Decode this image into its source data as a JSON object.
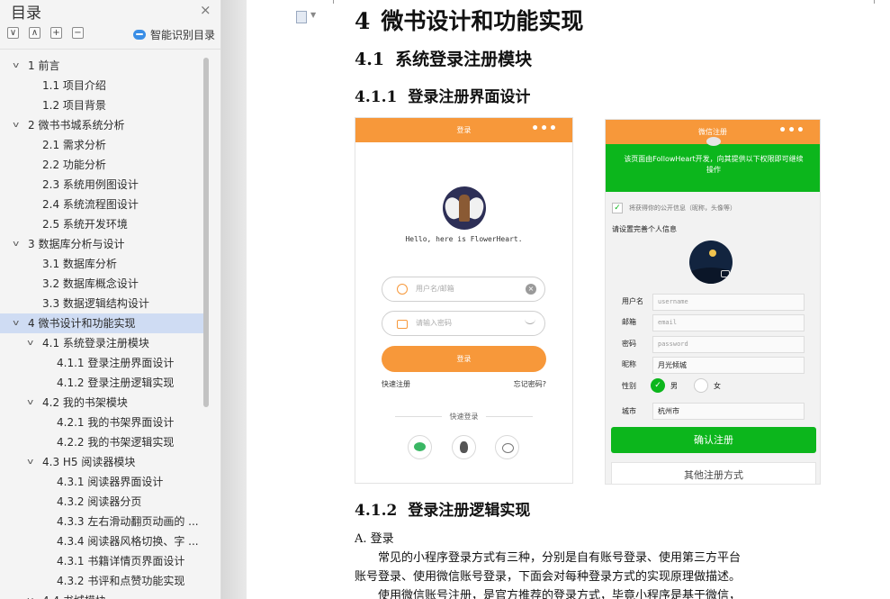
{
  "toc": {
    "title": "目录",
    "close": "×",
    "tools": [
      "∨",
      "∧",
      "+",
      "−"
    ],
    "smart_label": "智能识别目录",
    "items": [
      {
        "label": "1  前言",
        "level": 1,
        "expanded": true
      },
      {
        "label": "1.1  项目介绍",
        "level": 2
      },
      {
        "label": "1.2  项目背景",
        "level": 2
      },
      {
        "label": "2  微书书城系统分析",
        "level": 1,
        "expanded": true
      },
      {
        "label": "2.1  需求分析",
        "level": 2
      },
      {
        "label": "2.2  功能分析",
        "level": 2
      },
      {
        "label": "2.3  系统用例图设计",
        "level": 2
      },
      {
        "label": "2.4  系统流程图设计",
        "level": 2
      },
      {
        "label": "2.5  系统开发环境",
        "level": 2
      },
      {
        "label": "3  数据库分析与设计",
        "level": 1,
        "expanded": true
      },
      {
        "label": "3.1  数据库分析",
        "level": 2
      },
      {
        "label": "3.2  数据库概念设计",
        "level": 2
      },
      {
        "label": "3.3  数据逻辑结构设计",
        "level": 2
      },
      {
        "label": "4  微书设计和功能实现",
        "level": 1,
        "expanded": true,
        "active": true
      },
      {
        "label": "4.1  系统登录注册模块",
        "level": 2,
        "expanded": true
      },
      {
        "label": "4.1.1  登录注册界面设计",
        "level": 3
      },
      {
        "label": "4.1.2  登录注册逻辑实现",
        "level": 3
      },
      {
        "label": "4.2  我的书架模块",
        "level": 2,
        "expanded": true
      },
      {
        "label": "4.2.1  我的书架界面设计",
        "level": 3
      },
      {
        "label": "4.2.2  我的书架逻辑实现",
        "level": 3
      },
      {
        "label": "4.3 H5  阅读器模块",
        "level": 2,
        "expanded": true
      },
      {
        "label": "4.3.1  阅读器界面设计",
        "level": 3
      },
      {
        "label": "4.3.2  阅读器分页",
        "level": 3
      },
      {
        "label": "4.3.3  左右滑动翻页动画的 ...",
        "level": 3
      },
      {
        "label": "4.3.4  阅读器风格切换、字 ...",
        "level": 3
      },
      {
        "label": "4.3.1  书籍详情页界面设计",
        "level": 3
      },
      {
        "label": "4.3.2  书评和点赞功能实现",
        "level": 3
      },
      {
        "label": "4.4  书城模块",
        "level": 2,
        "expanded": true
      }
    ]
  },
  "doc": {
    "h1_num": "4",
    "h1_text": "微书设计和功能实现",
    "h2_num": "4.1",
    "h2_text": "系统登录注册模块",
    "h3a_num": "4.1.1",
    "h3a_text": "登录注册界面设计",
    "h3b_num": "4.1.2",
    "h3b_text": "登录注册逻辑实现",
    "para_a": "A.  登录",
    "line1": "常见的小程序登录方式有三种，分别是自有账号登录、使用第三方平台",
    "line2": "账号登录、使用微信账号登录，下面会对每种登录方式的实现原理做描述。",
    "line3": "使用微信账号注册，是官方推荐的登录方式，毕竟小程序是基于微信，"
  },
  "login_screen": {
    "title": "登录",
    "more": "•••",
    "hello": "Hello, here is FlowerHeart.",
    "username_placeholder": "用户名/邮箱",
    "clear": "×",
    "password_placeholder": "请输入密码",
    "login_button": "登录",
    "quick_register": "快速注册",
    "forgot_password": "忘记密码?",
    "quick_login": "快速登录"
  },
  "register_screen": {
    "title": "微信注册",
    "more": "•••",
    "notice": "该页面由FollowHeart开发，向其提供以下权限即可继续操作",
    "check": "✓",
    "consent": "将获得你的公开信息（昵称，头像等）",
    "set_info": "请设置完善个人信息",
    "fields": [
      {
        "label": "用户名",
        "value": "username"
      },
      {
        "label": "邮箱",
        "value": "email"
      },
      {
        "label": "密码",
        "value": "password"
      },
      {
        "label": "昵称",
        "value": "月光倾城"
      }
    ],
    "gender_label": "性别",
    "gender_mark": "✓",
    "male": "男",
    "female": "女",
    "city_label": "城市",
    "city_value": "杭州市",
    "confirm_button": "确认注册",
    "other_button": "其他注册方式"
  },
  "colors": {
    "orange": "#f7983a",
    "green": "#0cb61c",
    "active_toc": "#cfdcf3"
  }
}
